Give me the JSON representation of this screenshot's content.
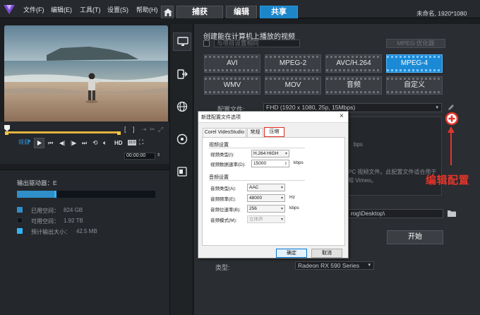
{
  "menu": {
    "items": [
      "文件(F)",
      "编辑(E)",
      "工具(T)",
      "设置(S)",
      "帮助(H)"
    ]
  },
  "tabs": {
    "home_icon": "home-icon",
    "items": [
      {
        "label": "捕获",
        "active": false
      },
      {
        "label": "编辑",
        "active": false
      },
      {
        "label": "共享",
        "active": true
      }
    ]
  },
  "project": {
    "info": "未命名, 1920*1080"
  },
  "player": {
    "mode_label": "项目",
    "hd_label": "HD",
    "ratio_label": "16:9",
    "timecode": "00:00:00"
  },
  "drive": {
    "label": "输出驱动器：E",
    "used_label": "已用空间：",
    "used_value": "824 GB",
    "free_label": "可用空间：",
    "free_value": "1.92 TB",
    "estimate_label": "预计输出大小：",
    "estimate_value": "42.5 MB",
    "used_fraction": 0.27,
    "used_color": "#2f8fc9",
    "free_color": "#0e141a",
    "estimate_color": "#33b4f5"
  },
  "share": {
    "heading": "创建能在计算机上播放的视频",
    "match_project_label": "与项目设置相同",
    "mpeg_optimizer_label": "MPEG 优化器",
    "formats": [
      {
        "label": "AVI",
        "selected": false
      },
      {
        "label": "MPEG-2",
        "selected": false
      },
      {
        "label": "AVC/H.264",
        "selected": false
      },
      {
        "label": "MPEG-4",
        "selected": true
      },
      {
        "label": "WMV",
        "selected": false
      },
      {
        "label": "MOV",
        "selected": false
      },
      {
        "label": "音频",
        "selected": false
      },
      {
        "label": "自定义",
        "selected": false
      }
    ],
    "profile_label": "配置文件:",
    "profile_value": "FHD (1920 x 1080, 25p, 15Mbps)",
    "desc_fragment_1": "bps",
    "desc_fragment_2": "PC 视频文件。此配置文件适合用于",
    "desc_fragment_3": "和 Vimeo。",
    "path_fragment": "rog\\Desktop\\",
    "encoder_label": "类型:",
    "encoder_value": "Radeon RX 590 Series",
    "start_label": "开始"
  },
  "dialog": {
    "title": "新建配置文件选项",
    "tabs": [
      "Corel VideoStudio",
      "常规",
      "压缩"
    ],
    "video_group": "视频设置",
    "video_type_label": "视频类型(I):",
    "video_type_value": "H.264 HIGH",
    "video_bitrate_label": "视频数据速率(D):",
    "video_bitrate_value": "15000",
    "video_bitrate_unit": "kbps",
    "audio_group": "音频设置",
    "audio_type_label": "音频类型(A):",
    "audio_type_value": "AAC",
    "audio_freq_label": "音频频率(E):",
    "audio_freq_value": "48000",
    "audio_freq_unit": "Hz",
    "audio_bitrate_label": "音频位速率(B):",
    "audio_bitrate_value": "256",
    "audio_bitrate_unit": "kbps",
    "audio_mode_label": "音频模式(M):",
    "audio_mode_value": "立体声",
    "ok_label": "确定",
    "cancel_label": "取消"
  },
  "annotation": {
    "text": "编辑配置",
    "color": "#e4352b"
  }
}
